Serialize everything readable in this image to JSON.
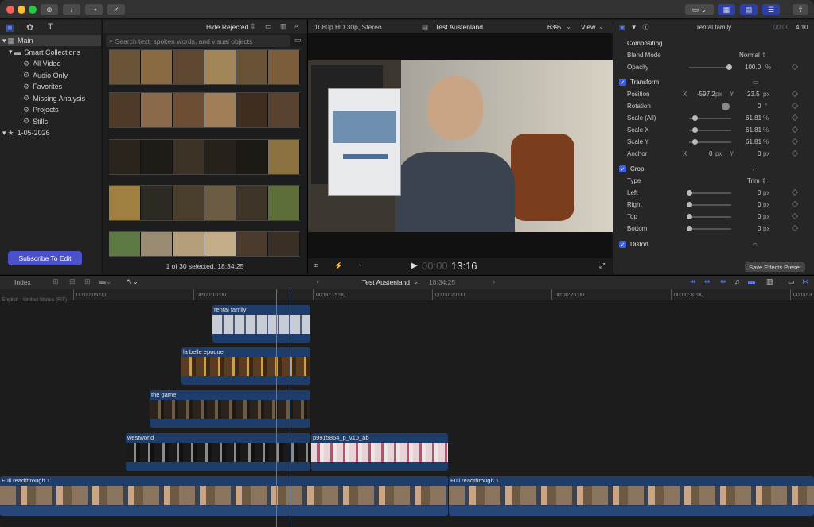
{
  "toolbar": {
    "share_hint": "share",
    "colors": {
      "close": "#ff5f57",
      "min": "#febc2e",
      "max": "#28c840",
      "accent": "#2f3fa8"
    }
  },
  "library": {
    "items": [
      {
        "label": "Main",
        "icon": "grid-icon",
        "level": 0,
        "selected": true
      },
      {
        "label": "Smart Collections",
        "icon": "folder-icon",
        "level": 1
      },
      {
        "label": "All Video",
        "icon": "gear-icon",
        "level": 2
      },
      {
        "label": "Audio Only",
        "icon": "gear-icon",
        "level": 2
      },
      {
        "label": "Favorites",
        "icon": "gear-icon",
        "level": 2
      },
      {
        "label": "Missing Analysis",
        "icon": "gear-icon",
        "level": 2
      },
      {
        "label": "Projects",
        "icon": "gear-icon",
        "level": 2
      },
      {
        "label": "Stills",
        "icon": "gear-icon",
        "level": 2
      },
      {
        "label": "1-05-2026",
        "icon": "star-icon",
        "level": 0
      }
    ],
    "subscribe_label": "Subscribe To Edit"
  },
  "browser": {
    "filter_label": "Hide Rejected",
    "search_placeholder": "Search text, spoken words, and visual objects",
    "status": "1 of 30 selected, 18:34:25"
  },
  "viewer": {
    "format": "1080p HD 30p, Stereo",
    "project_name": "Test Austenland",
    "zoom": "63%",
    "view_label": "View",
    "timecode_dim": "00:00",
    "timecode": "13:16"
  },
  "inspector": {
    "clip_name": "rental family",
    "duration": "4:10",
    "duration_prefix": "00:00",
    "compositing": {
      "title": "Compositing",
      "blend_label": "Blend Mode",
      "blend_value": "Normal",
      "opacity_label": "Opacity",
      "opacity_value": "100.0",
      "opacity_unit": "%"
    },
    "transform": {
      "title": "Transform",
      "position_label": "Position",
      "pos_x_label": "X",
      "pos_x": "-597.2",
      "pos_y_label": "Y",
      "pos_y": "23.5",
      "unit_px": "px",
      "rotation_label": "Rotation",
      "rotation": "0",
      "rotation_unit": "°",
      "scale_all_label": "Scale (All)",
      "scale_all": "61.81",
      "scale_x_label": "Scale X",
      "scale_x": "61.81",
      "scale_y_label": "Scale Y",
      "scale_y": "61.81",
      "unit_pct": "%",
      "anchor_label": "Anchor",
      "anchor_x_label": "X",
      "anchor_x": "0",
      "anchor_y_label": "Y",
      "anchor_y": "0"
    },
    "crop": {
      "title": "Crop",
      "type_label": "Type",
      "type_value": "Trim",
      "left_label": "Left",
      "left": "0",
      "right_label": "Right",
      "right": "0",
      "top_label": "Top",
      "top": "0",
      "bottom_label": "Bottom",
      "bottom": "0",
      "unit": "px"
    },
    "distort": {
      "title": "Distort"
    },
    "save_label": "Save Effects Preset"
  },
  "timeline": {
    "index_label": "Index",
    "project_name": "Test Austenland",
    "duration": "18:34:25",
    "ruler": [
      "00:00:05:00",
      "00:00:10:00",
      "00:00:15:00",
      "00:00:20:00",
      "00:00:25:00",
      "00:00:30:00",
      "00:00:3"
    ],
    "role_label": "English - United States (FIT)",
    "clips": [
      {
        "name": "rental family"
      },
      {
        "name": "la belle epoque"
      },
      {
        "name": "the game"
      },
      {
        "name": "westworld"
      },
      {
        "name": "p9915864_p_v10_ab"
      },
      {
        "name": "Full readthrough 1"
      },
      {
        "name": "Full readthrough 1"
      }
    ]
  }
}
